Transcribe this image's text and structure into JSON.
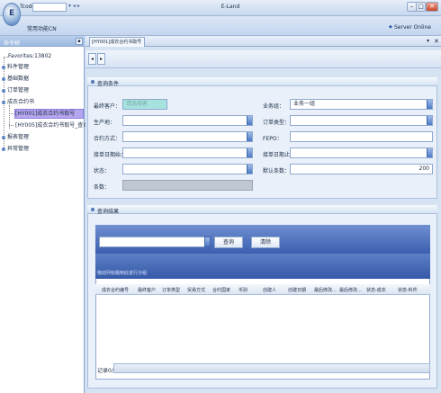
{
  "titlebar": {
    "tcode_label": "Tcode",
    "title": "E-Land",
    "min": "–",
    "max": "□",
    "close": "✕"
  },
  "menu": {
    "common_label": "常用功能CN",
    "server_status": "Server Online"
  },
  "sidebar": {
    "title": "命令树",
    "items": [
      "Favorites:13802",
      "料件管理",
      "基础数据",
      "订单管理",
      "成衣合约书",
      "[HY001]成衣合约书取号",
      "[HY005]成衣合约书取号_查询",
      "报表管理",
      "异常管理"
    ]
  },
  "tabs": {
    "active": "[HY001]成衣合约书取号",
    "dropdown": "▾",
    "close": "✕"
  },
  "toolbar": {
    "prev": "◂",
    "next": "▸"
  },
  "query": {
    "title": "查询条件",
    "fields": {
      "customer_label": "最终客户：",
      "customer_value": "请选择客",
      "business_label": "业务组：",
      "business_value": "业务一组",
      "origin_label": "生产地：",
      "order_type_label": "订单类型：",
      "contract_method_label": "合约方式：",
      "fepo_label": "FEPO：",
      "order_date_start_label": "接单日期始：",
      "order_date_end_label": "接单日期止：",
      "status_label": "状态：",
      "default_count_label": "默认条数：",
      "default_count_value": "200",
      "count_label": "条数："
    }
  },
  "results": {
    "title": "查询结果",
    "query_button": "查询",
    "clear_button": "清除",
    "group_hint": "拖动列标题到此进行分组",
    "columns": [
      "成衣合约编号",
      "最终客户",
      "订单类型",
      "贸易方式",
      "合约国家",
      "币别",
      "创建人",
      "创建日期",
      "最后修改...",
      "最后修改...",
      "状态-成衣",
      "状态-料件"
    ],
    "record_label": "记录0/0"
  },
  "colors": {
    "selection": "#b6a6f0",
    "header_blue": "#3b5faf"
  }
}
